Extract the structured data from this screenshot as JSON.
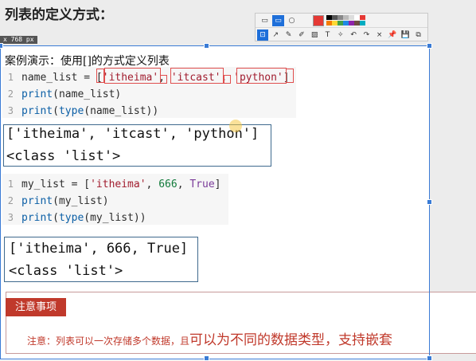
{
  "title": "列表的定义方式：",
  "dimension_badge": "x 768  px",
  "toolbar": {
    "row1": [
      "▭",
      "▭",
      "○"
    ],
    "active_color": "#e53935",
    "palette": [
      "#000000",
      "#555555",
      "#888888",
      "#bbbbbb",
      "#dddddd",
      "#ffffff",
      "#e53935",
      "#f57c00",
      "#fdd835",
      "#43a047",
      "#1e88e5",
      "#8e24aa",
      "#6d4c41",
      "#00acc1"
    ],
    "row2": [
      "⊡",
      "↗",
      "✎",
      "✐",
      "▨",
      "T",
      "✧",
      "↶",
      "↷",
      "×",
      "📌",
      "💾",
      "⧉"
    ]
  },
  "demo_label": "案例演示：使用[]的方式定义列表",
  "code1": {
    "lines": [
      {
        "n": "1",
        "parts": [
          [
            "name_list = ",
            ""
          ],
          [
            "[",
            ""
          ],
          [
            "'itheima'",
            "str"
          ],
          [
            ", ",
            ""
          ],
          [
            "'itcast'",
            "str"
          ],
          [
            ", ",
            ""
          ],
          [
            "'python'",
            "str"
          ],
          [
            "]",
            ""
          ]
        ]
      },
      {
        "n": "2",
        "parts": [
          [
            "print",
            "kw"
          ],
          [
            "(name_list)",
            ""
          ]
        ]
      },
      {
        "n": "3",
        "parts": [
          [
            "print",
            "kw"
          ],
          [
            "(",
            ""
          ],
          [
            "type",
            "kw"
          ],
          [
            "(name_list))",
            ""
          ]
        ]
      }
    ]
  },
  "output1": [
    "['itheima', 'itcast', 'python']",
    "<class 'list'>"
  ],
  "code2": {
    "lines": [
      {
        "n": "1",
        "parts": [
          [
            "my_list = [",
            ""
          ],
          [
            "'itheima'",
            "str"
          ],
          [
            ", ",
            ""
          ],
          [
            "666",
            "num"
          ],
          [
            ", ",
            ""
          ],
          [
            "True",
            "bool"
          ],
          [
            "]",
            ""
          ]
        ]
      },
      {
        "n": "2",
        "parts": [
          [
            "print",
            "kw"
          ],
          [
            "(my_list)",
            ""
          ]
        ]
      },
      {
        "n": "3",
        "parts": [
          [
            "print",
            "kw"
          ],
          [
            "(",
            ""
          ],
          [
            "type",
            "kw"
          ],
          [
            "(my_list))",
            ""
          ]
        ]
      }
    ]
  },
  "output2": [
    "['itheima', 666, True]",
    "<class 'list'>"
  ],
  "note": {
    "tag": "注意事项",
    "text_small": "注意：列表可以一次存储多个数据，且",
    "text_big": "可以为不同的数据类型，支持嵌套"
  }
}
